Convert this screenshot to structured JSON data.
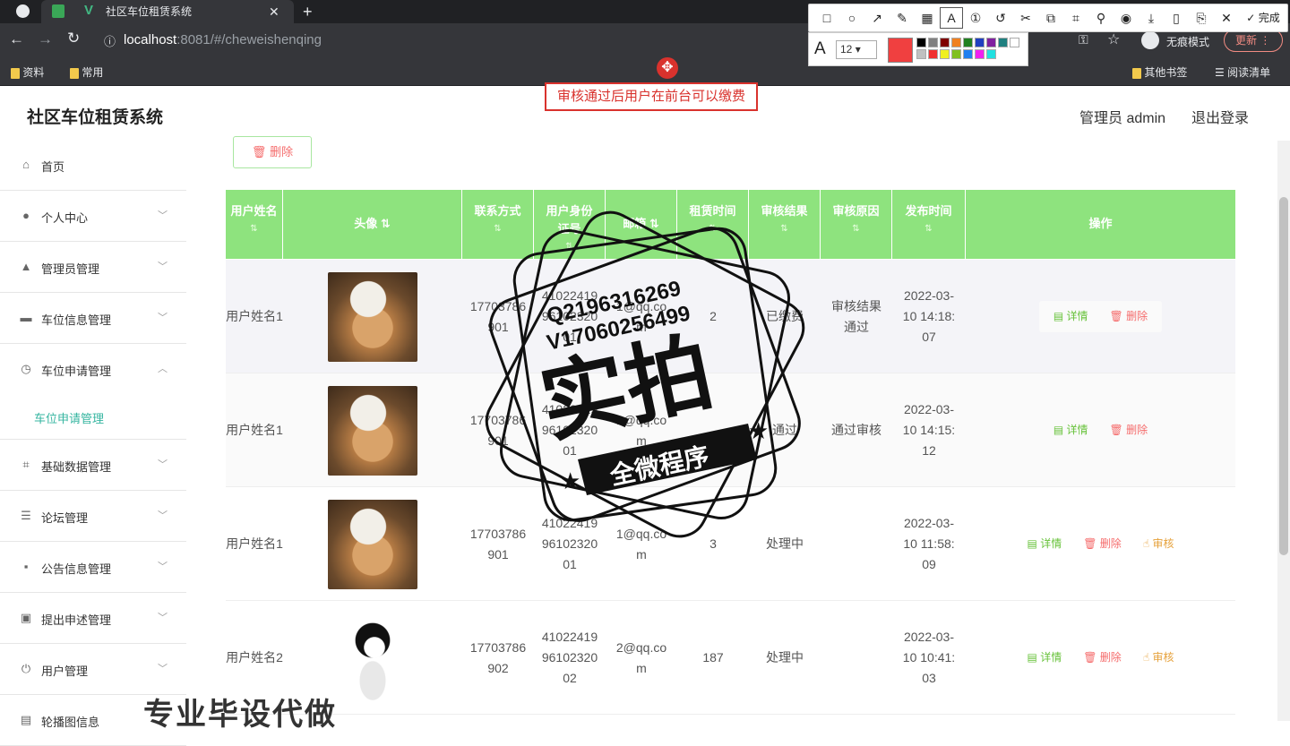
{
  "browser": {
    "tab_title": "社区车位租赁系统",
    "url_host": "localhost",
    "url_rest": ":8081/#/cheweishenqing",
    "incognito_label": "无痕模式",
    "update_label": "更新",
    "bookmarks": [
      "资料",
      "常用"
    ],
    "bookmarks_right": [
      "其他书签",
      "阅读清单"
    ]
  },
  "annotation_tool": {
    "done_label": "完成",
    "font_size": "12",
    "current_color": "#f04040",
    "palette": [
      "#000000",
      "#808080",
      "#800000",
      "#f08020",
      "#208020",
      "#2040c0",
      "#8020a0",
      "#208080",
      "#ffffff",
      "#c0c0c0",
      "#f03030",
      "#f0f020",
      "#80c020",
      "#2080f0",
      "#f020f0",
      "#20e0e0"
    ]
  },
  "callout_text": "审核通过后用户在前台可以缴费",
  "app": {
    "title": "社区车位租赁系统",
    "user_label": "管理员 admin",
    "logout_label": "退出登录"
  },
  "sidebar": {
    "items": [
      {
        "label": "首页",
        "icon": "home-icon"
      },
      {
        "label": "个人中心",
        "icon": "user-icon"
      },
      {
        "label": "管理员管理",
        "icon": "admin-icon"
      },
      {
        "label": "车位信息管理",
        "icon": "parking-icon"
      },
      {
        "label": "车位申请管理",
        "icon": "clock-icon"
      },
      {
        "label": "车位申请管理",
        "icon": ""
      },
      {
        "label": "基础数据管理",
        "icon": "crop-icon"
      },
      {
        "label": "论坛管理",
        "icon": "sliders-icon"
      },
      {
        "label": "公告信息管理",
        "icon": "chat-icon"
      },
      {
        "label": "提出申述管理",
        "icon": "clipboard-icon"
      },
      {
        "label": "用户管理",
        "icon": "power-icon"
      },
      {
        "label": "轮播图信息",
        "icon": "image-icon"
      }
    ]
  },
  "toolbar": {
    "delete_label": "删除"
  },
  "table": {
    "headers": [
      "用户姓名",
      "头像",
      "联系方式",
      "用户身份证号",
      "邮箱",
      "租赁时间",
      "审核结果",
      "审核原因",
      "发布时间",
      "操作"
    ],
    "rows": [
      {
        "name": "用户姓名1",
        "phone": "17703786901",
        "idcard": "410224199610232001",
        "email": "1@qq.com",
        "rent": "2",
        "result": "已缴费",
        "reason": "审核结果通过",
        "time": "2022-03-10 14:18:07",
        "ops": [
          "详情",
          "删除"
        ]
      },
      {
        "name": "用户姓名1",
        "phone": "17703786901",
        "idcard": "410224199610232001",
        "email": "1@qq.com",
        "rent": "",
        "result": "通过",
        "reason": "通过审核",
        "time": "2022-03-10 14:15:12",
        "ops": [
          "详情",
          "删除"
        ]
      },
      {
        "name": "用户姓名1",
        "phone": "17703786901",
        "idcard": "410224199610232001",
        "email": "1@qq.com",
        "rent": "3",
        "result": "处理中",
        "reason": "",
        "time": "2022-03-10 11:58:09",
        "ops": [
          "详情",
          "删除",
          "审核"
        ]
      },
      {
        "name": "用户姓名2",
        "phone": "17703786902",
        "idcard": "410224199610232002",
        "email": "2@qq.com",
        "rent": "187",
        "result": "处理中",
        "reason": "",
        "time": "2022-03-10 10:41:03",
        "ops": [
          "详情",
          "删除",
          "审核"
        ]
      }
    ]
  },
  "stamp": {
    "qq": "Q2196316269",
    "v": "V17060256499",
    "main": "实拍",
    "ribbon": "全微程序"
  },
  "watermark": "专业毕设代做"
}
